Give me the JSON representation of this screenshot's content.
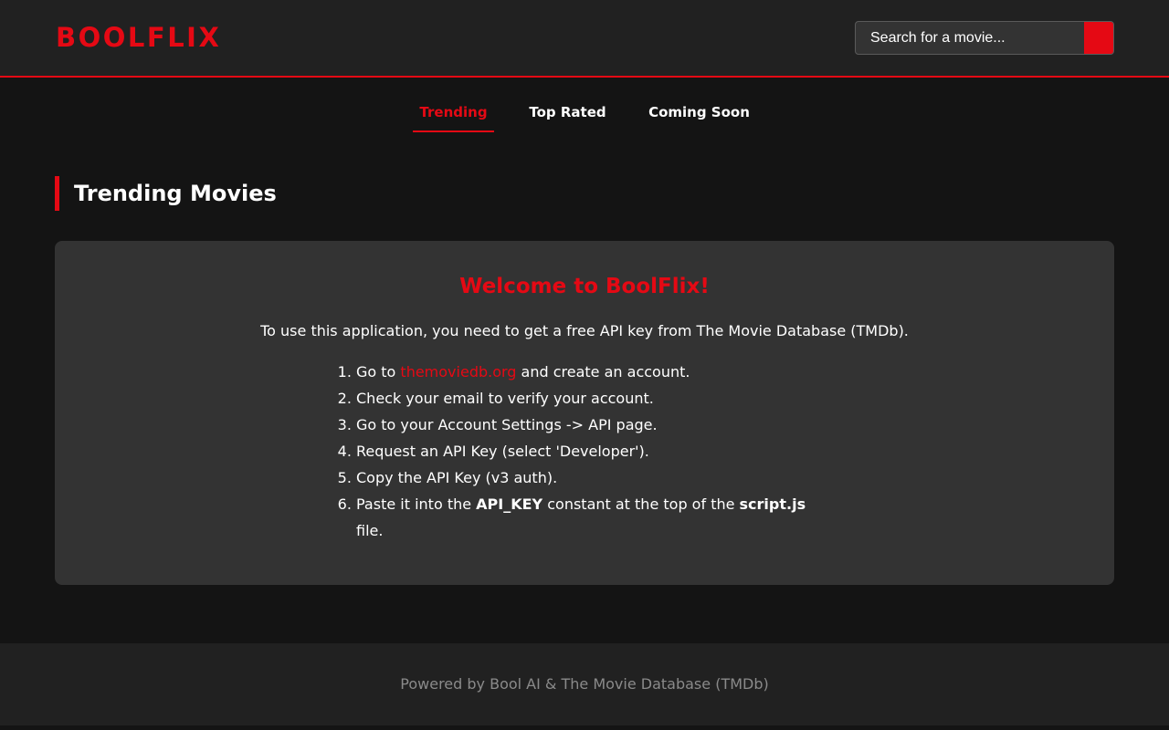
{
  "header": {
    "logo": "BOOLFLIX",
    "search_placeholder": "Search for a movie...",
    "accent_color": "#e50914"
  },
  "nav": {
    "items": [
      {
        "label": "Trending",
        "active": true
      },
      {
        "label": "Top Rated",
        "active": false
      },
      {
        "label": "Coming Soon",
        "active": false
      }
    ]
  },
  "main": {
    "section_title": "Trending Movies",
    "card": {
      "title": "Welcome to BoolFlix!",
      "intro": "To use this application, you need to get a free API key from The Movie Database (TMDb).",
      "steps": {
        "s1_prefix": "Go to ",
        "s1_link": "themoviedb.org",
        "s1_suffix": " and create an account.",
        "s2": "Check your email to verify your account.",
        "s3": "Go to your Account Settings -> API page.",
        "s4": "Request an API Key (select 'Developer').",
        "s5": "Copy the API Key (v3 auth).",
        "s6_prefix": "Paste it into the ",
        "s6_bold1": "API_KEY",
        "s6_middle": " constant at the top of the ",
        "s6_bold2": "script.js",
        "s6_suffix": " file."
      }
    }
  },
  "footer": {
    "text": "Powered by Bool AI & The Movie Database (TMDb)"
  }
}
